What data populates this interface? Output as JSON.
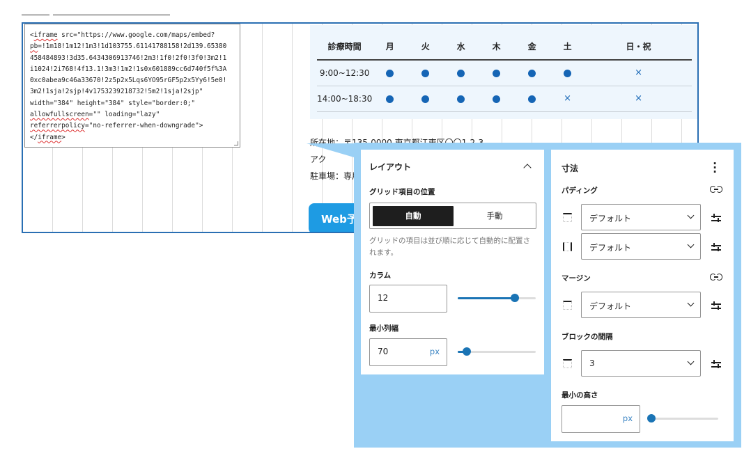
{
  "code": {
    "lines": [
      "<iframe src=\"https://www.google.com/maps/embed?",
      "pb=!1m18!1m12!1m3!1d103755.61141788158!2d139.65380",
      "458484893!3d35.6434306913746!2m3!1f0!2f0!3f0!3m2!1",
      "i1024!2i768!4f13.1!3m3!1m2!1s0x601889cc6d740f5f%3A",
      "0xc0abea9c46a33670!2z5p2x5Lqs6YO95rGF5p2x5Yy6!5e0!",
      "3m2!1sja!2sjp!4v1753239218732!5m2!1sja!2sjp\"",
      "width=\"384\" height=\"384\" style=\"border:0;\"",
      "allowfullscreen=\"\" loading=\"lazy\"",
      "referrerpolicy=\"no-referrer-when-downgrade\">",
      "</iframe>"
    ]
  },
  "hours": {
    "header": [
      "診療時間",
      "月",
      "火",
      "水",
      "木",
      "金",
      "土",
      "日・祝"
    ],
    "rows": [
      {
        "time": "9:00~12:30",
        "marks": [
          "dot",
          "dot",
          "dot",
          "dot",
          "dot",
          "dot",
          "cross"
        ]
      },
      {
        "time": "14:00~18:30",
        "marks": [
          "dot",
          "dot",
          "dot",
          "dot",
          "dot",
          "cross",
          "cross"
        ]
      }
    ],
    "cross_symbol": "×"
  },
  "address": {
    "line1": "所在地：〒135-0000 東京都江東区〇〇1-2-3",
    "line2": "アク",
    "line3": "駐車場：専用"
  },
  "web_button": {
    "label": "Web予"
  },
  "layout_panel": {
    "title": "レイアウト",
    "grid_position_label": "グリッド項目の位置",
    "toggle_auto": "自動",
    "toggle_manual": "手動",
    "help": "グリッドの項目は並び順に応じて自動的に配置されます。",
    "columns_label": "カラム",
    "columns_value": "12",
    "columns_slider": 0.73,
    "min_col_width_label": "最小列幅",
    "min_col_width_value": "70",
    "min_col_width_unit": "px",
    "min_col_width_slider": 0.12
  },
  "dimensions_panel": {
    "title": "寸法",
    "padding_label": "パディング",
    "padding_top": "デフォルト",
    "padding_sides": "デフォルト",
    "margin_label": "マージン",
    "margin_value": "デフォルト",
    "block_gap_label": "ブロックの間隔",
    "block_gap_value": "3",
    "min_height_label": "最小の高さ",
    "min_height_value": "",
    "min_height_unit": "px",
    "min_height_slider": 0.0
  },
  "colors": {
    "accent": "#1a74b5",
    "panel_bg": "#9ad0f5",
    "editor_border": "#2a6fb3",
    "table_bg": "#eef6fd",
    "button": "#1e9be3"
  }
}
